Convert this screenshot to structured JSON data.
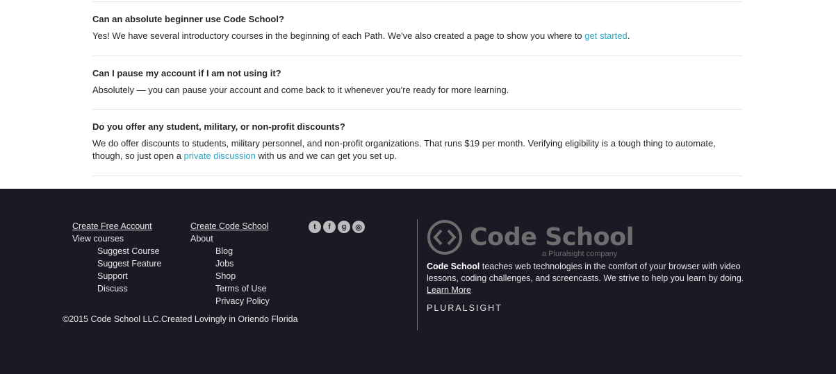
{
  "faq": [
    {
      "question": "Can an absolute beginner use Code School?",
      "answer_pre": "Yes! We have several introductory courses in the beginning of each Path. We've also created a page to show you where to ",
      "answer_link": "get started",
      "answer_post": "."
    },
    {
      "question": "Can I pause my account if I am not using it?",
      "answer": "Absolutely — you can pause your account and come back to it whenever you're ready for more learning."
    },
    {
      "question": "Do you offer any student, military, or non-profit discounts?",
      "answer_pre": "We do offer discounts to students, military personnel, and non-profit organizations. That runs $19 per month. Verifying eligibility is a tough thing to automate, though, so just open a ",
      "answer_link": "private discussion",
      "answer_post": " with us and we can get you set up."
    }
  ],
  "footer": {
    "col1": {
      "create_account": "Create Free Account",
      "view_courses": "View courses",
      "sub": [
        "Suggest Course",
        "Suggest Feature",
        "Support",
        "Discuss"
      ]
    },
    "col2": {
      "create_school": "Create Code School",
      "about": "About",
      "sub": [
        "Blog",
        "Jobs",
        "Shop",
        "Terms of Use",
        "Privacy Policy"
      ]
    },
    "social_icons": [
      "twitter-icon",
      "facebook-icon",
      "google-plus-icon",
      "instagram-icon"
    ],
    "copyright": "©2015 Code School LLC.Created Lovingly in Oriendo Florida",
    "brand": {
      "logo_text": "Code School",
      "logo_sub": "a Pluralsight company",
      "desc_bold": "Code School",
      "desc": " teaches web technologies in the comfort of your browser with video lessons, coding challenges, and screencasts. We strive to help you learn by doing. ",
      "learn_more": "Learn More",
      "pluralsight": "PLURALSIGHT"
    }
  }
}
